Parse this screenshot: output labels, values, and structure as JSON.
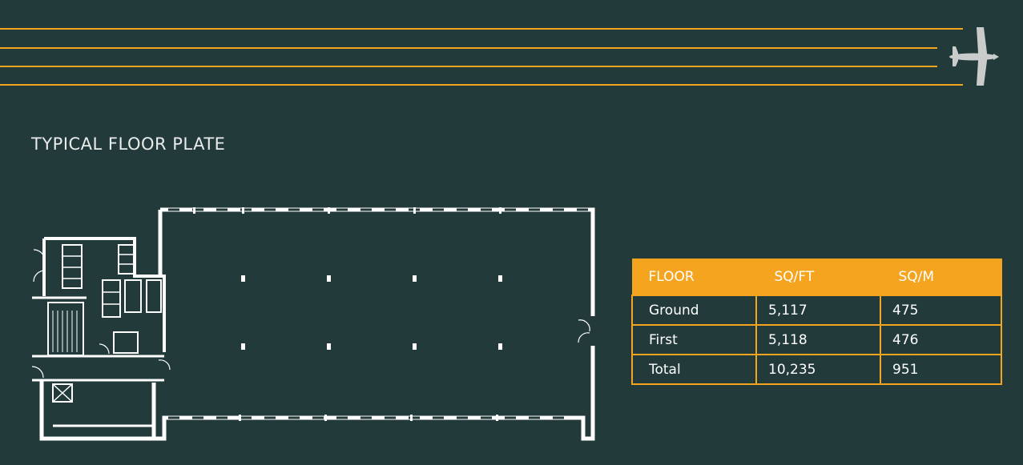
{
  "header": {
    "title": "TYPICAL FLOOR PLATE",
    "accent_color": "#f4a41f",
    "background_color": "#233a3b",
    "icon": "airplane-icon"
  },
  "floor_plan": {
    "icon": "floor-plan-drawing"
  },
  "area_table": {
    "columns": [
      "FLOOR",
      "SQ/FT",
      "SQ/M"
    ],
    "rows": [
      {
        "floor": "Ground",
        "sqft": "5,117",
        "sqm": "475"
      },
      {
        "floor": "First",
        "sqft": "5,118",
        "sqm": "476"
      },
      {
        "floor": "Total",
        "sqft": "10,235",
        "sqm": "951"
      }
    ]
  }
}
